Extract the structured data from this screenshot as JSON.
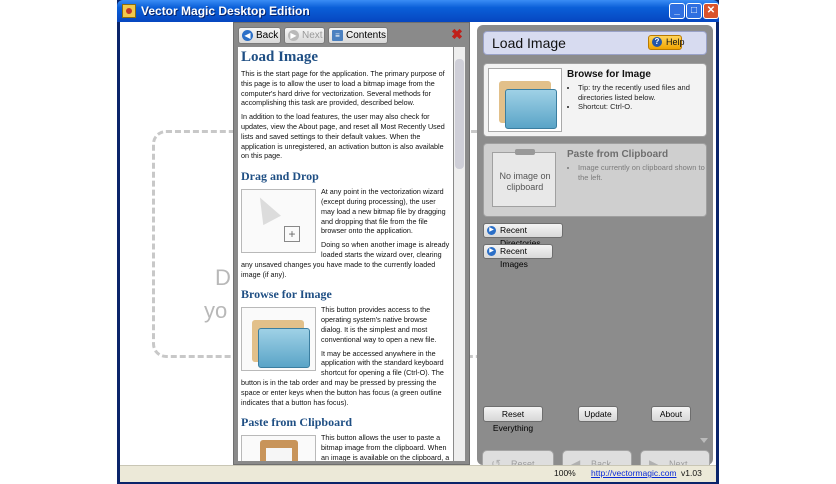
{
  "window": {
    "title": "Vector Magic Desktop Edition"
  },
  "window_controls": {
    "minimize": "_",
    "maximize": "□",
    "close": "✕"
  },
  "background": {
    "line1": "D",
    "line2": "yo"
  },
  "help_panel": {
    "toolbar": {
      "back": "Back",
      "next": "Next",
      "contents": "Contents"
    },
    "title": "Load Image",
    "intro": [
      "This is the start page for the application. The primary purpose of this page is to allow the user to load a bitmap image from the computer's hard drive for vectorization. Several methods for accomplishing this task are provided, described below.",
      "In addition to the load features, the user may also check for updates, view the About page, and reset all Most Recently Used lists and saved settings to their default values. When the application is unregistered, an activation button is also available on this page."
    ],
    "sections": [
      {
        "heading": "Drag and Drop",
        "paragraphs": [
          "At any point in the vectorization wizard (except during processing), the user may load a new bitmap file by dragging and dropping that file from the file browser onto the application.",
          "Doing so when another image is already loaded starts the wizard over, clearing any unsaved changes you have made to the currently loaded image (if any)."
        ]
      },
      {
        "heading": "Browse for Image",
        "paragraphs": [
          "This button provides access to the operating system's native browse dialog. It is the simplest and most conventional way to open a new file.",
          "It may be accessed anywhere in the application with the standard keyboard shortcut for opening a file (Ctrl-O). The button is in the tab order and may be pressed by pressing the space or enter keys when the button has focus (a green outline indicates that a button has focus)."
        ]
      },
      {
        "heading": "Paste from Clipboard",
        "paragraphs": [
          "This button allows the user to paste a bitmap image from the clipboard. When an image is available on the clipboard, a"
        ]
      }
    ]
  },
  "right_panel": {
    "title": "Load Image",
    "help_label": "Help",
    "browse": {
      "title": "Browse for Image",
      "tips": [
        "Tip: try the recently used files and directories listed below.",
        "Shortcut: Ctrl-O."
      ]
    },
    "clipboard": {
      "title": "Paste from Clipboard",
      "placeholder": "No image on clipboard",
      "tips": [
        "Image currently on clipboard shown to the left."
      ]
    },
    "recent_directories": "Recent Directories",
    "recent_images": "Recent Images",
    "buttons": {
      "reset_everything": "Reset Everything",
      "update": "Update",
      "about": "About"
    }
  },
  "nav": {
    "reset": "Reset",
    "back": "Back",
    "next": "Next"
  },
  "status": {
    "zoom": "100%",
    "link": "http://vectormagic.com",
    "version": "v1.03"
  }
}
